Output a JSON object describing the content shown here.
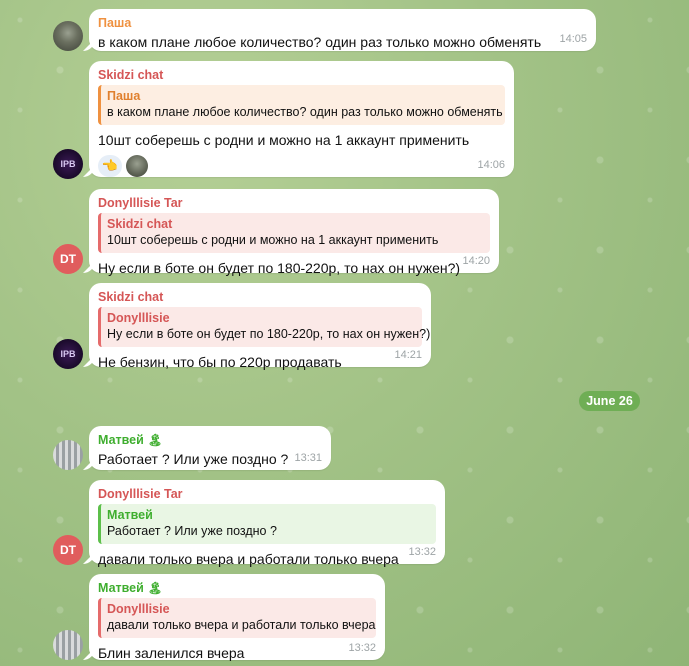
{
  "colors": {
    "pasha": "#ef9140",
    "skidzi": "#d55656",
    "donyl": "#d55656",
    "matvey": "#3fae2f",
    "date_chip": "#6fae55"
  },
  "messages": [
    {
      "sender": "Паша",
      "text": "в каком плане любое количество? один раз только можно обменять",
      "time": "14:05"
    },
    {
      "sender": "Skidzi chat",
      "reply_name": "Паша",
      "reply_text": "в каком плане любое количество? один раз только можно обменять",
      "text": "10шт соберешь с родни и можно на 1 аккаунт применить",
      "reaction": "👈",
      "time": "14:06"
    },
    {
      "sender": "Donylllisie Tar",
      "avatar": "DT",
      "reply_name": "Skidzi chat",
      "reply_text": "10шт соберешь с родни и можно на 1 аккаунт применить",
      "text": "Ну если в боте он будет по 180-220р, то нах он нужен?)",
      "time": "14:20"
    },
    {
      "sender": "Skidzi chat",
      "reply_name": "Donylllisie",
      "reply_text": "Ну если в боте он будет по 180-220р, то нах он нужен?)",
      "text": "Не бензин, что бы по 220р продавать",
      "time": "14:21"
    },
    {
      "sender": "Матвей",
      "sender_emoji": "🏝",
      "text": "Работает ? Или уже поздно ?",
      "time": "13:31"
    },
    {
      "sender": "Donylllisie Tar",
      "avatar": "DT",
      "reply_name": "Матвей",
      "reply_text": "Работает ? Или уже поздно ?",
      "text": "давали только вчера и работали только вчера",
      "time": "13:32"
    },
    {
      "sender": "Матвей",
      "sender_emoji": "🏝",
      "reply_name": "Donylllisie",
      "reply_text": "давали только вчера и работали только вчера",
      "text": "Блин заленился вчера",
      "time": "13:32"
    }
  ],
  "date_separator": "June 26"
}
